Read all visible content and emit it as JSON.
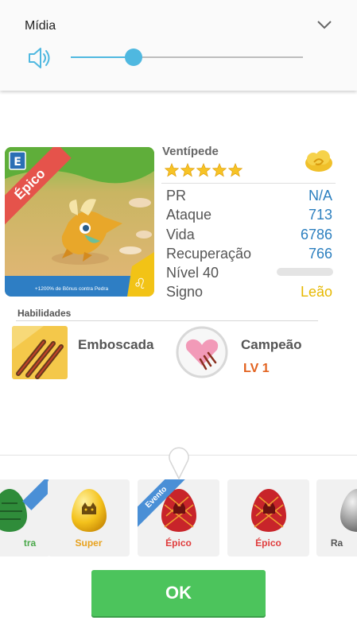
{
  "media": {
    "title": "Mídia",
    "volume_level": 0.27,
    "icons": {
      "expand": "chevron-down-icon",
      "volume": "speaker-icon"
    }
  },
  "monster": {
    "name": "Ventípede",
    "rarity": "Épico",
    "star_count": 5,
    "bonus_text": "+1200% de Bônus contra Pedra",
    "level_progress": 0,
    "stats": [
      {
        "label": "PR",
        "value": "N/A"
      },
      {
        "label": "Ataque",
        "value": "713"
      },
      {
        "label": "Vida",
        "value": "6786"
      },
      {
        "label": "Recuperação",
        "value": "766"
      },
      {
        "label": "Nível 40",
        "value": ""
      },
      {
        "label": "Signo",
        "value": "Leão"
      }
    ]
  },
  "abilities": {
    "label": "Habilidades",
    "skill_name": "Emboscada",
    "champion_name": "Campeão",
    "champion_level": "LV 1"
  },
  "eggs": [
    {
      "label": "tra"
    },
    {
      "label": "Super"
    },
    {
      "label": "Épico",
      "badge": "Evento"
    },
    {
      "label": "Épico"
    },
    {
      "label": "Ra"
    }
  ],
  "ok_button": "OK",
  "colors": {
    "accent_blue": "#4fb8e0",
    "stat_value": "#2c7fbf",
    "gold": "#e6b800",
    "ok_green": "#4cc45c",
    "epic_red": "#e03c3c"
  }
}
